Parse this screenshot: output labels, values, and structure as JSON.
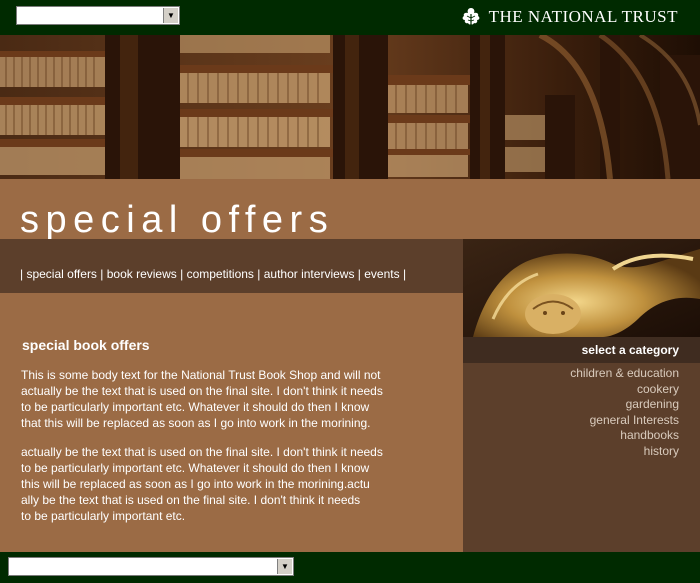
{
  "header": {
    "site_name": "THE NATIONAL TRUST",
    "logo_icon": "oak-leaf-icon",
    "selector_value": "",
    "selector_icon": "chevron-down-icon"
  },
  "banner": {
    "image": "library-bookshelves"
  },
  "page": {
    "title": "special offers"
  },
  "nav": {
    "prefix": "| ",
    "separator": " | ",
    "suffix": " |",
    "items": [
      "special offers",
      "book reviews",
      "competitions",
      "author interviews",
      "events"
    ]
  },
  "main": {
    "heading": "special book offers",
    "paragraphs": [
      [
        "This is some body text for the National Trust Book Shop and will not",
        "actually be the text that is used on the final site.  I don't think it needs",
        "to be particularly important etc.  Whatever it should do then I know",
        "that this will be replaced as soon as I go into work in the morining."
      ],
      [
        "actually be the text that is used on the final site.  I don't think it needs",
        "to be particularly important etc.  Whatever it should do then I know",
        "this will be replaced as soon as I go into work in the morining.actu",
        "ally be the text that is used on the final site.  I don't think it needs",
        "to be particularly important etc."
      ]
    ]
  },
  "sidebar": {
    "image": "gilded-statue",
    "heading": "select a category",
    "categories": [
      "children & education",
      "cookery",
      "gardening",
      "general Interests",
      "handbooks",
      "history"
    ]
  },
  "footer": {
    "selector_value": "",
    "selector_icon": "chevron-down-icon"
  },
  "colors": {
    "dark_green": "#002a00",
    "page_brown": "#9b6b45",
    "panel_brown": "#5c3f2b",
    "side_header": "#3f2c20",
    "category_text": "#d9cbbd"
  }
}
